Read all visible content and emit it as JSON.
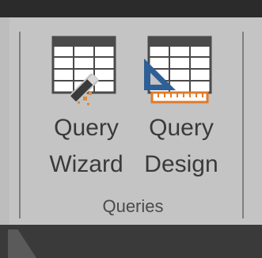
{
  "ribbon": {
    "group_label": "Queries",
    "buttons": [
      {
        "label_line1": "Query",
        "label_line2": "Wizard",
        "icon": "query-wizard-icon"
      },
      {
        "label_line1": "Query",
        "label_line2": "Design",
        "icon": "query-design-icon"
      }
    ]
  },
  "colors": {
    "ribbon_bg": "#c4c4c4",
    "top_bar": "#2b2b2b",
    "text": "#3a3a3a",
    "table_header": "#4a4a4a",
    "triangle_blue": "#2e5f96",
    "ruler_orange": "#e07a28",
    "wand_dark": "#3a3a3a",
    "sparkle_orange": "#e08a3a"
  }
}
